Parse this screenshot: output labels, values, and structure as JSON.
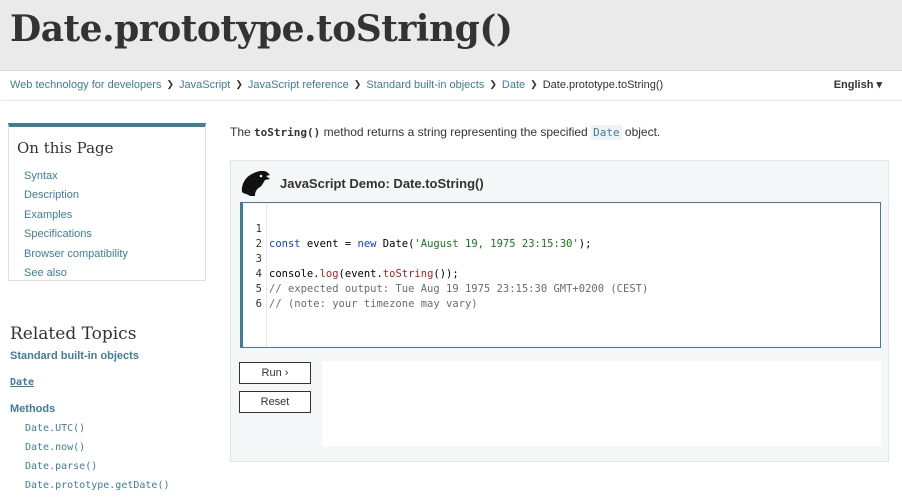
{
  "page": {
    "title": "Date.prototype.toString()"
  },
  "breadcrumbs": {
    "items": [
      "Web technology for developers",
      "JavaScript",
      "JavaScript reference",
      "Standard built-in objects",
      "Date"
    ],
    "current": "Date.prototype.toString()"
  },
  "language": {
    "label": "English ▾"
  },
  "toc": {
    "title": "On this Page",
    "items": [
      "Syntax",
      "Description",
      "Examples",
      "Specifications",
      "Browser compatibility",
      "See also"
    ]
  },
  "related": {
    "title": "Related Topics",
    "section": "Standard built-in objects",
    "object": "Date",
    "methods_label": "Methods",
    "methods": [
      "Date.UTC()",
      "Date.now()",
      "Date.parse()",
      "Date.prototype.getDate()"
    ]
  },
  "intro": {
    "before": "The ",
    "method": "toString()",
    "middle": " method returns a string representing the specified ",
    "object": "Date",
    "after": " object."
  },
  "demo": {
    "title": "JavaScript Demo: Date.toString()",
    "line_numbers": [
      "1",
      "2",
      "3",
      "4",
      "5",
      "6"
    ],
    "code": {
      "l1": {
        "kw1": "const",
        "t1": " event = ",
        "kw2": "new",
        "t2": " Date(",
        "str": "'August 19, 1975 23:15:30'",
        "t3": ");"
      },
      "l3": {
        "t1": "console.",
        "fn1": "log",
        "t2": "(event.",
        "fn2": "toString",
        "t3": "());"
      },
      "l4": "// expected output: Tue Aug 19 1975 23:15:30 GMT+0200 (CEST)",
      "l5": "// (note: your timezone may vary)"
    },
    "run_label": "Run ›",
    "reset_label": "Reset"
  },
  "colors": {
    "link": "#3d7e9a",
    "header_bg": "#eaeaea",
    "keyword": "#0a3df5",
    "string": "#137a13",
    "function": "#c4191c",
    "comment": "#6c6c6c"
  },
  "icons": {
    "demo_logo": "dinosaur-head-icon"
  }
}
